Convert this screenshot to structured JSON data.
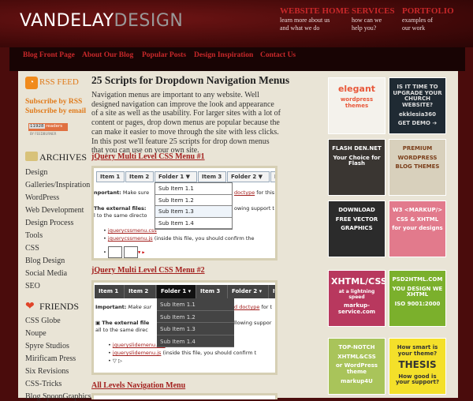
{
  "header": {
    "logo_main": "VANDELAY",
    "logo_accent": "DESIGN",
    "links": [
      {
        "label": "WEBSITE HOME",
        "sub1": "learn more about us",
        "sub2": "and what we do"
      },
      {
        "label": "SERVICES",
        "sub1": "how can we",
        "sub2": "help you?"
      },
      {
        "label": "PORTFOLIO",
        "sub1": "examples of",
        "sub2": "our work"
      }
    ]
  },
  "nav": [
    "Blog Front Page",
    "About Our Blog",
    "Popular Posts",
    "Design Inspiration",
    "Contact Us"
  ],
  "sidebar": {
    "rss": "RSS FEED",
    "sub_rss": "Subscribe by RSS",
    "sub_email": "Subscribe by email",
    "readers": "11928",
    "readers_label": "readers",
    "feedburner": "BY FEEDBURNER",
    "archives_title": "ARCHIVES",
    "archives": [
      "Design",
      "Galleries/Inspiration",
      "WordPress",
      "Web Development",
      "Design Process",
      "Tools",
      "CSS",
      "Blog Design",
      "Social Media",
      "SEO"
    ],
    "friends_title": "FRIENDS",
    "friends": [
      "CSS Globe",
      "Noupe",
      "Spyre Studios",
      "Mirificam Press",
      "Six Revisions",
      "CSS-Tricks",
      "Blog SpoonGraphics"
    ]
  },
  "post": {
    "title": "25 Scripts for Dropdown Navigation Menus",
    "body": "Navigation menus are important to any website. Well designed navigation can improve the look and appearance of a site as well as the usability. For larger sites with a lot of content or pages, drop down menus are popular because the can make it easier to move through the site with less clicks. In this post we'll feature 25 scripts for drop down menus that you can use on your own site.",
    "s1": {
      "title": "jQuery Multi Level CSS Menu #1",
      "tabs": [
        "Item 1",
        "Item 2",
        "Folder 1 ▼",
        "Item 3",
        "Folder 2 ▼",
        "It"
      ],
      "sub": [
        "Sub Item 1.1",
        "Sub Item 1.2",
        "Sub Item 1.3",
        "Sub Item 1.4"
      ],
      "t1a": "nportant:",
      "t1b": "Make sure",
      "t1c": "doctype",
      "t1d": "for this",
      "t2a": "The external files:",
      "t2b": "owing support t",
      "t3": "l to the same directo",
      "f1": "jquerycssmenu.css",
      "f2": "jquerycssmenu.js",
      "f2b": "(inside this file, you should confirm the"
    },
    "s2": {
      "title": "jQuery Multi Level CSS Menu #2",
      "tabs": [
        "Item 1",
        "Item 2",
        "Folder 1 ▾",
        "Item 3",
        "Folder 2 ▾",
        "It"
      ],
      "sub": [
        "Sub Item 1.1",
        "Sub Item 1.2",
        "Sub Item 1.3",
        "Sub Item 1.4"
      ],
      "t1a": "Important:",
      "t1b": "Make sur",
      "t1c": "d doctype",
      "t1d": "for t",
      "t2a": "The external file",
      "t2b": "llowing suppor",
      "t3": "all to the same direc",
      "f1": "jqueryslidemenu.css",
      "f2": "jqueryslidemenu.js",
      "f2b": "(inside this file, you should confirm t",
      "f3": "▽ ▷"
    },
    "s3": {
      "title": "All Levels Navigation Menu"
    }
  },
  "ads": [
    {
      "l1": "elegant",
      "l2": "wordpress themes",
      "bg": "#f4f2ec",
      "fg": "#e8583a"
    },
    {
      "l1": "IS IT TIME TO UPGRADE YOUR CHURCH WEBSITE?",
      "l2": "ekklesia360",
      "l3": "GET DEMO ➔",
      "bg": "#1f2a33",
      "fg": "#ddd"
    },
    {
      "l1": "FLASH DEN.NET",
      "l2": "Your Choice for Flash",
      "bg": "#3a3632",
      "fg": "#fff"
    },
    {
      "l1": "PREMIUM",
      "l2": "WORDPRESS",
      "l3": "BLOG THEMES",
      "bg": "#d8d0bc",
      "fg": "#7a3e1a"
    },
    {
      "l1": "DOWNLOAD",
      "l2": "FREE VECTOR",
      "l3": "GRAPHICS",
      "bg": "#2b2b2b",
      "fg": "#fff"
    },
    {
      "l1": "W3 <MARKUP/>",
      "l2": "CSS & XHTML",
      "l3": "for your designs",
      "bg": "#e27a8c",
      "fg": "#fff"
    },
    {
      "l1": "XHTML/CSS",
      "l2": "at a lightning speed",
      "l3": "markup-service.com",
      "bg": "#b8385e",
      "fg": "#fff"
    },
    {
      "l1": "PSD2HTML.COM",
      "l2": "YOU DESIGN WE XHTML",
      "l3": "ISO 9001:2000",
      "bg": "#7bb02c",
      "fg": "#fff"
    },
    {
      "l1": "TOP-NOTCH",
      "l2": "XHTML&CSS",
      "l3": "or WordPress theme",
      "l4": "markup4U",
      "bg": "#a9c45a",
      "fg": "#fff"
    },
    {
      "l1": "How smart is your theme?",
      "l2": "THESIS",
      "l3": "How good is your support?",
      "bg": "#f4e02a",
      "fg": "#333"
    }
  ]
}
